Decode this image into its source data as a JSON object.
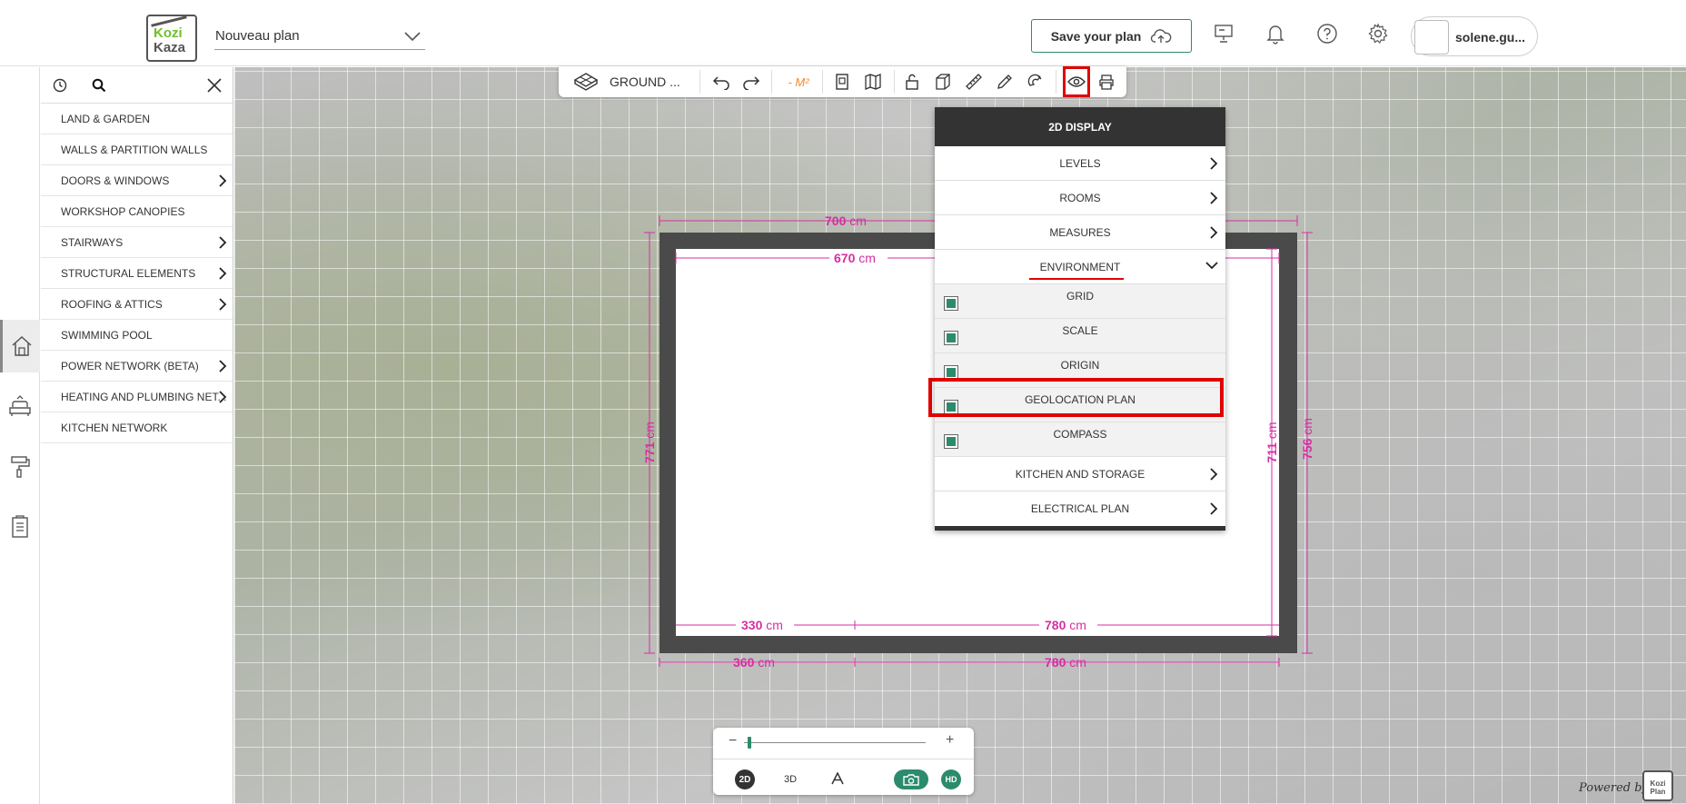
{
  "header": {
    "logo_line1": "Kozi",
    "logo_line2": "Kaza",
    "plan_name": "Nouveau plan",
    "save_label": "Save your plan",
    "username": "solene.gu..."
  },
  "sidebar": {
    "items": [
      {
        "label": "LAND & GARDEN",
        "has_submenu": false
      },
      {
        "label": "WALLS & PARTITION WALLS",
        "has_submenu": false
      },
      {
        "label": "DOORS & WINDOWS",
        "has_submenu": true
      },
      {
        "label": "WORKSHOP CANOPIES",
        "has_submenu": false
      },
      {
        "label": "STAIRWAYS",
        "has_submenu": true
      },
      {
        "label": "STRUCTURAL ELEMENTS",
        "has_submenu": true
      },
      {
        "label": "ROOFING & ATTICS",
        "has_submenu": true
      },
      {
        "label": "SWIMMING POOL",
        "has_submenu": false
      },
      {
        "label": "POWER NETWORK (BETA)",
        "has_submenu": true
      },
      {
        "label": "HEATING AND PLUMBING NET...",
        "has_submenu": true
      },
      {
        "label": "KITCHEN NETWORK",
        "has_submenu": false
      }
    ]
  },
  "toolbar": {
    "level_label": "GROUND ...",
    "area_label": "- M²"
  },
  "display_menu": {
    "title": "2D DISPLAY",
    "levels": "LEVELS",
    "rooms": "ROOMS",
    "measures": "MEASURES",
    "environment": "ENVIRONMENT",
    "env_items": [
      {
        "label": "GRID",
        "checked": true
      },
      {
        "label": "SCALE",
        "checked": true
      },
      {
        "label": "ORIGIN",
        "checked": true
      },
      {
        "label": "GEOLOCATION PLAN",
        "checked": true
      },
      {
        "label": "COMPASS",
        "checked": true
      }
    ],
    "kitchen": "KITCHEN AND STORAGE",
    "electrical": "ELECTRICAL PLAN"
  },
  "plan": {
    "top_outer": "700",
    "top_inner": "670",
    "left_outer": "771",
    "right_inner": "711",
    "right_outer": "756",
    "bottom_inner_a": "330",
    "bottom_inner_b": "780",
    "bottom_outer_a": "360",
    "bottom_outer_b": "780",
    "unit": "cm"
  },
  "view": {
    "mode_2d": "2D",
    "mode_3d": "3D",
    "hd": "HD"
  },
  "footer": {
    "powered_by": "Powered by",
    "badge": "Kozi Plan"
  },
  "colors": {
    "accent": "#2c8b6c",
    "dimension": "#d62fa3",
    "highlight": "#e00000",
    "wall": "#4a4a4a"
  }
}
